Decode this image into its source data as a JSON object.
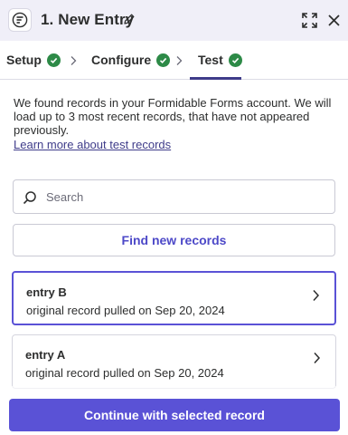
{
  "header": {
    "title": "1. New Entry",
    "app_icon": "formidable-forms-logo",
    "actions": [
      "edit-icon",
      "expand-icon",
      "close-icon"
    ]
  },
  "steps": [
    {
      "label": "Setup",
      "status": "complete"
    },
    {
      "label": "Configure",
      "status": "complete"
    },
    {
      "label": "Test",
      "status": "complete",
      "active": true
    }
  ],
  "info": {
    "text": "We found records in your Formidable Forms account. We will load up to 3 most recent records, that have not appeared previously.",
    "link": "Learn more about test records"
  },
  "search": {
    "placeholder": "Search",
    "value": ""
  },
  "find_button": "Find new records",
  "records": [
    {
      "name": "entry B",
      "detail": "original record pulled on Sep 20, 2024",
      "selected": true
    },
    {
      "name": "entry A",
      "detail": "original record pulled on Sep 20, 2024",
      "selected": false
    }
  ],
  "continue_button": "Continue with selected record",
  "colors": {
    "accent": "#5a52d6",
    "link": "#3f3c8a",
    "success": "#2d8a47",
    "header_bg": "#f0eff8"
  }
}
